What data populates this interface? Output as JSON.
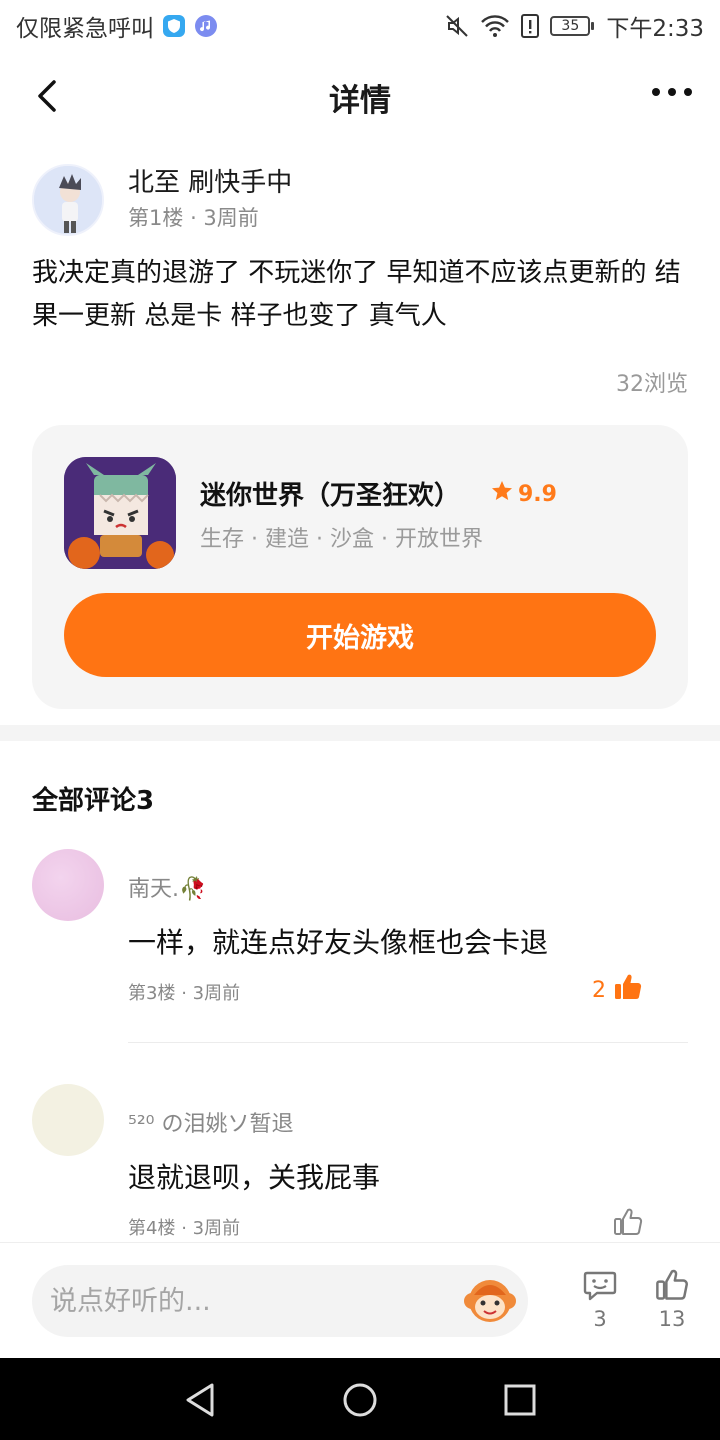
{
  "status_bar": {
    "carrier": "仅限紧急呼叫",
    "time": "下午2:33",
    "battery": "35",
    "icons": [
      "shield-app-icon",
      "music-app-icon",
      "mute-icon",
      "wifi-icon",
      "alert-icon",
      "battery-icon"
    ]
  },
  "header": {
    "title": "详情",
    "back_icon": "chevron-left-icon",
    "more_icon": "more-dots-icon"
  },
  "post": {
    "author": "北至 刷快手中",
    "floor": "第1楼",
    "time": "3周前",
    "body": "我决定真的退游了 不玩迷你了 早知道不应该点更新的 结果一更新 总是卡 样子也变了 真气人",
    "views": "32浏览"
  },
  "game_card": {
    "name": "迷你世界（万圣狂欢）",
    "rating": "9.9",
    "tags": "生存 · 建造 · 沙盒 · 开放世界",
    "play_label": "开始游戏"
  },
  "comments": {
    "title": "全部评论3",
    "items": [
      {
        "user": "南天.🥀",
        "text": "一样，就连点好友头像框也会卡退",
        "floor": "第3楼",
        "time": "3周前",
        "likes": "2"
      },
      {
        "user": "⁵²⁰ の泪姚ソ暂退",
        "text": "退就退呗，关我屁事",
        "floor": "第4楼",
        "time": "3周前",
        "likes": ""
      }
    ]
  },
  "bottom_bar": {
    "input_placeholder": "说点好听的...",
    "comment_count": "3",
    "like_count": "13"
  },
  "colors": {
    "accent": "#ff7413",
    "card_bg": "#f5f5f5",
    "muted_text": "#8a8a8a"
  }
}
